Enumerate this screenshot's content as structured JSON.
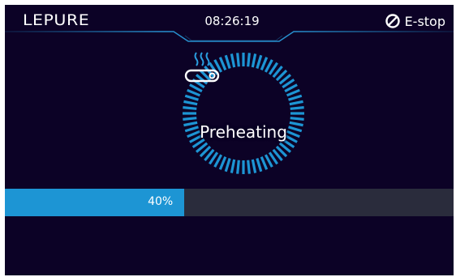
{
  "header": {
    "logo_text": "LEPURE",
    "time": "08:26:19",
    "estop_label": "E-stop",
    "estop_icon": "prohibited-icon"
  },
  "status": {
    "label": "Preheating",
    "icon": "heater-icon",
    "ring_color": "#1d95d4"
  },
  "progress": {
    "percent": 40,
    "label": "40%",
    "fill_color": "#1d95d4",
    "track_color": "#2a2c3c"
  },
  "colors": {
    "background": "#0c0226",
    "accent": "#1d95d4"
  }
}
